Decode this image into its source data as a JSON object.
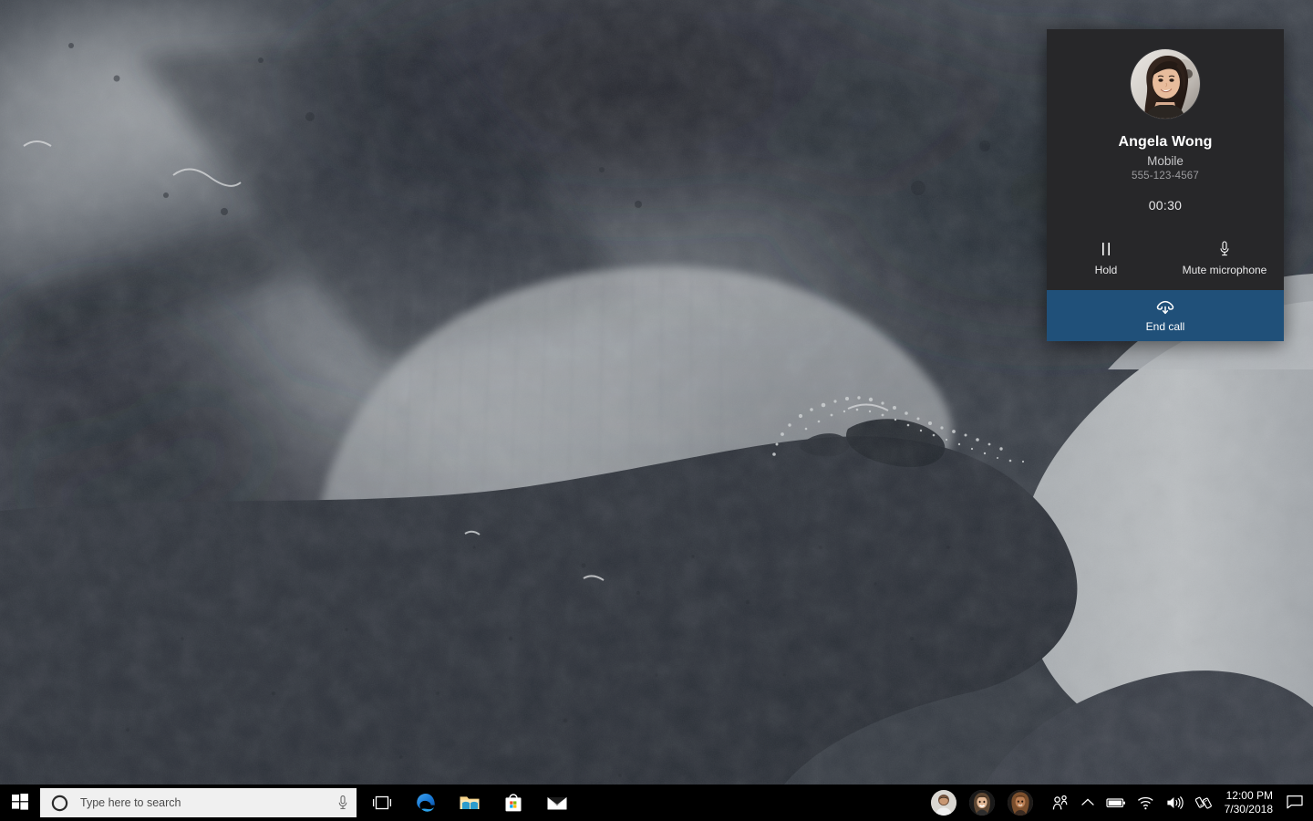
{
  "desktop": {
    "wallpaper_description": "grayscale aerial satellite photograph of ice and dark open water",
    "wallpaper_colors": {
      "dark": "#2f333b",
      "mid": "#555a63",
      "light": "#c3c6c9",
      "highlight": "#e8eaea"
    }
  },
  "call_panel": {
    "name": "call-flyout",
    "contact_name": "Angela Wong",
    "contact_type": "Mobile",
    "phone_number": "555-123-4567",
    "call_duration": "00:30",
    "background_color": "#272729",
    "actions": [
      {
        "id": "hold",
        "label": "Hold",
        "icon": "pause-icon"
      },
      {
        "id": "mute",
        "label": "Mute microphone",
        "icon": "microphone-icon"
      }
    ],
    "end_call": {
      "label": "End call",
      "icon": "end-call-icon",
      "color": "#205079"
    }
  },
  "taskbar": {
    "background_color": "#000000",
    "start": {
      "label": "Start",
      "icon": "windows-logo-icon"
    },
    "search": {
      "placeholder": "Type here to search",
      "value": "",
      "left_icon": "cortana-ring-icon",
      "right_icon": "microphone-icon",
      "background_color": "#f0f0f0"
    },
    "pinned": [
      {
        "id": "task-view",
        "label": "Task View",
        "icon": "task-view-icon"
      },
      {
        "id": "edge",
        "label": "Microsoft Edge",
        "icon": "edge-icon"
      },
      {
        "id": "file-explorer",
        "label": "File Explorer",
        "icon": "folder-icon"
      },
      {
        "id": "store",
        "label": "Microsoft Store",
        "icon": "store-bag-icon"
      },
      {
        "id": "mail",
        "label": "Mail",
        "icon": "envelope-icon"
      }
    ],
    "people": [
      {
        "id": "contact-1",
        "label": "Contact 1",
        "icon": "avatar"
      },
      {
        "id": "contact-2",
        "label": "Contact 2",
        "icon": "avatar"
      },
      {
        "id": "contact-3",
        "label": "Contact 3",
        "icon": "avatar"
      }
    ],
    "people_button": {
      "label": "People",
      "icon": "people-icon"
    },
    "tray": {
      "overflow": {
        "label": "Show hidden icons",
        "icon": "chevron-up-icon"
      },
      "items": [
        {
          "id": "battery",
          "label": "Battery",
          "icon": "battery-icon"
        },
        {
          "id": "network",
          "label": "Network",
          "icon": "wifi-icon"
        },
        {
          "id": "volume",
          "label": "Volume",
          "icon": "speaker-icon"
        },
        {
          "id": "phone-link",
          "label": "Your Phone",
          "icon": "phone-link-icon"
        }
      ]
    },
    "clock": {
      "time": "12:00 PM",
      "date": "7/30/2018"
    },
    "action_center": {
      "label": "Action Center",
      "icon": "action-center-icon"
    }
  }
}
